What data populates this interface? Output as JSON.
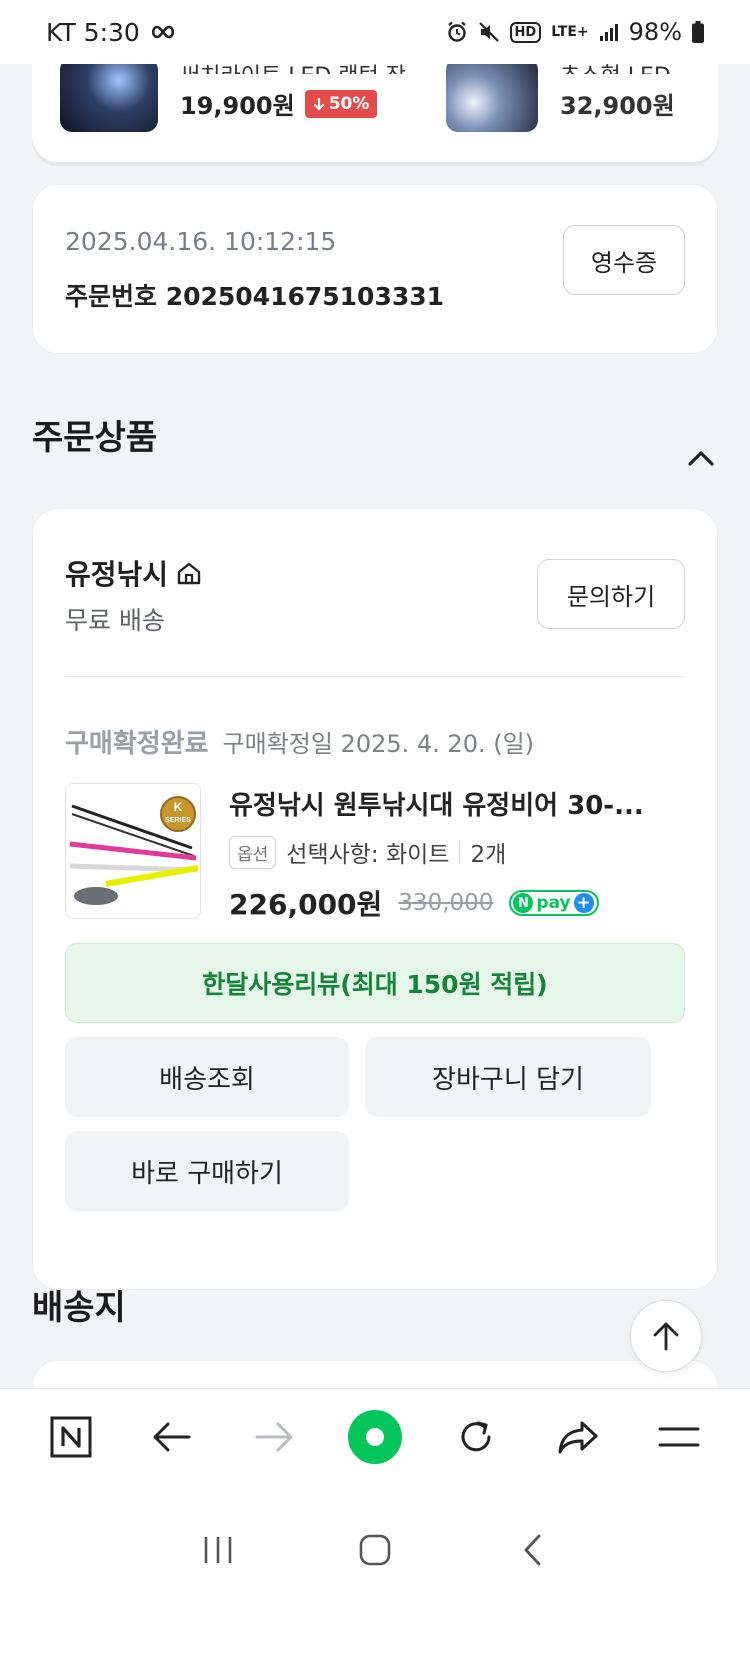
{
  "status_bar": {
    "carrier_time": "KT 5:30",
    "battery": "98%",
    "lte_label": "LTE+",
    "hd_label": "HD"
  },
  "recommendations": [
    {
      "title": "써치라이트 LED 랜턴 작...",
      "price": "19,900원",
      "discount": "50%"
    },
    {
      "title": "초소형 LED 손전등",
      "price": "32,900원"
    }
  ],
  "order": {
    "datetime": "2025.04.16. 10:12:15",
    "order_number": "주문번호 2025041675103331",
    "receipt_label": "영수증"
  },
  "ordered_products": {
    "section_title": "주문상품",
    "seller": {
      "name": "유정낚시",
      "shipping": "무료 배송",
      "inquiry_label": "문의하기"
    },
    "status": "구매확정완료",
    "status_date": "구매확정일 2025. 4. 20. (일)",
    "product": {
      "title": "유정낚시 원투낚시대 유정비어 30-...",
      "option_badge": "옵션",
      "option_text": "선택사항: 화이트",
      "quantity": "2개",
      "price": "226,000원",
      "original_price": "330,000",
      "npay_text": "pay",
      "thumb_badge_top": "K",
      "thumb_badge_bottom": "SERIES"
    },
    "review_button": "한달사용리뷰(최대 150원 적립)",
    "track_button": "배송조회",
    "cart_button": "장바구니 담기",
    "buy_button": "바로 구매하기"
  },
  "shipping_section_title": "배송지",
  "colors": {
    "brand_green": "#03c75a",
    "review_green_text": "#14843a",
    "review_green_bg": "#e6f7ea",
    "discount_red": "#e64b4b",
    "npay_plus_blue": "#1b8ef0"
  },
  "toolbar_icons": [
    "naver-home-icon",
    "back-arrow-icon",
    "forward-arrow-icon",
    "green-dot-icon",
    "refresh-icon",
    "share-icon",
    "menu-icon"
  ],
  "nav_icons": [
    "recent-apps-icon",
    "home-icon",
    "back-icon"
  ]
}
